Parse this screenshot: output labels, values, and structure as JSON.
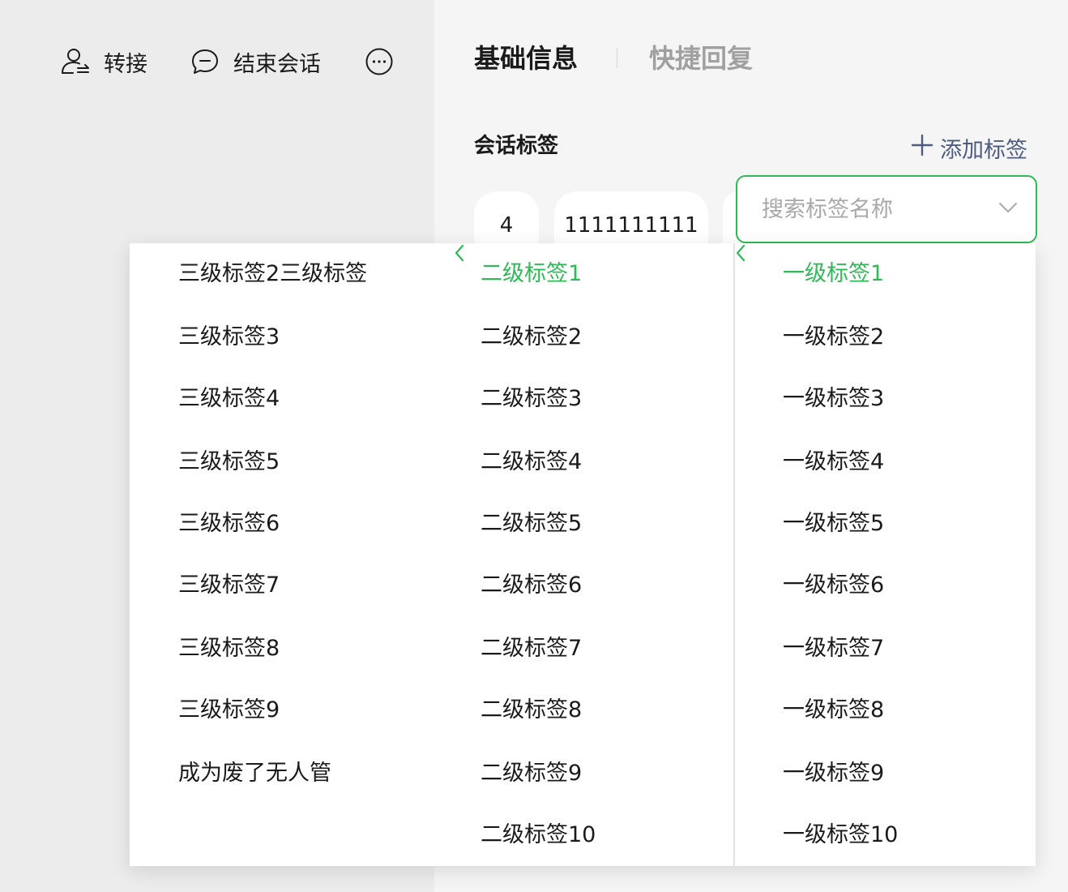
{
  "toolbar": {
    "transfer_label": "转接",
    "end_session_label": "结束会话"
  },
  "tabs": {
    "basic_info": "基础信息",
    "quick_reply": "快捷回复"
  },
  "session_tags": {
    "title": "会话标签",
    "add_label": "添加标签",
    "chips": [
      "4",
      "1111111111"
    ]
  },
  "search": {
    "placeholder": "搜索标签名称",
    "value": ""
  },
  "cascader": {
    "level3": [
      "三级标签2三级标签",
      "三级标签3",
      "三级标签4",
      "三级标签5",
      "三级标签6",
      "三级标签7",
      "三级标签8",
      "三级标签9",
      "成为废了无人管"
    ],
    "level2": [
      "二级标签1",
      "二级标签2",
      "二级标签3",
      "二级标签4",
      "二级标签5",
      "二级标签6",
      "二级标签7",
      "二级标签8",
      "二级标签9",
      "二级标签10"
    ],
    "level1": [
      "一级标签1",
      "一级标签2",
      "一级标签3",
      "一级标签4",
      "一级标签5",
      "一级标签6",
      "一级标签7",
      "一级标签8",
      "一级标签9",
      "一级标签10"
    ]
  },
  "colors": {
    "accent": "#2fba57",
    "link": "#4d5c7e",
    "tab_inactive": "#a0a0a0"
  }
}
